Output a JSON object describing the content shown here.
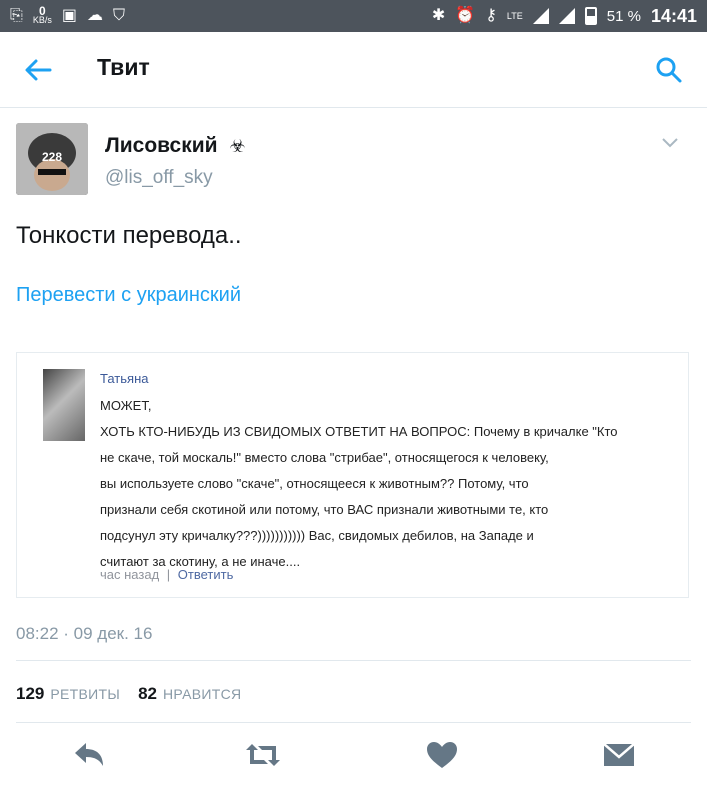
{
  "statusbar": {
    "speed_value": "0",
    "speed_unit": "KB/s",
    "network": "LTE",
    "battery": "51 %",
    "time": "14:41"
  },
  "header": {
    "title": "Твит"
  },
  "tweet": {
    "name": "Лисовский",
    "name_symbol": "☣",
    "handle": "@lis_off_sky",
    "avatar_text": "228",
    "text": "Тонкости перевода..",
    "translate_link": "Перевести с украинский",
    "date": "08:22 · 09 дек. 16",
    "retweets_count": "129",
    "retweets_label": "РЕТВИТЫ",
    "likes_count": "82",
    "likes_label": "НРАВИТСЯ"
  },
  "embedded": {
    "author": "Татьяна",
    "line1": "МОЖЕТ,",
    "line2": "ХОТЬ КТО-НИБУДЬ ИЗ СВИДОМЫХ ОТВЕТИТ НА ВОПРОС: Почему в кричалке \"Кто",
    "line3": "не скаче, той москаль!\" вместо слова \"стрибае\", относящегося к человеку,",
    "line4": "вы используете слово \"скаче\", относящееся к животным?? Потому, что",
    "line5": "признали себя скотиной или потому, что ВАС признали животными те, кто",
    "line6": "подсунул эту кричалку???))))))))))) Вас, свидомых дебилов, на Западе и",
    "line7": "считают за скотину, а не иначе....",
    "time": "час назад",
    "separator": "|",
    "reply": "Ответить"
  },
  "icons": {
    "back": "arrow-left-icon",
    "search": "search-icon",
    "menu": "chevron-down-icon",
    "reply": "reply-icon",
    "retweet": "retweet-icon",
    "like": "heart-icon",
    "dm": "envelope-icon"
  },
  "colors": {
    "accent": "#1da1f2",
    "muted": "#8899a6",
    "statusbar": "#4d545c"
  }
}
